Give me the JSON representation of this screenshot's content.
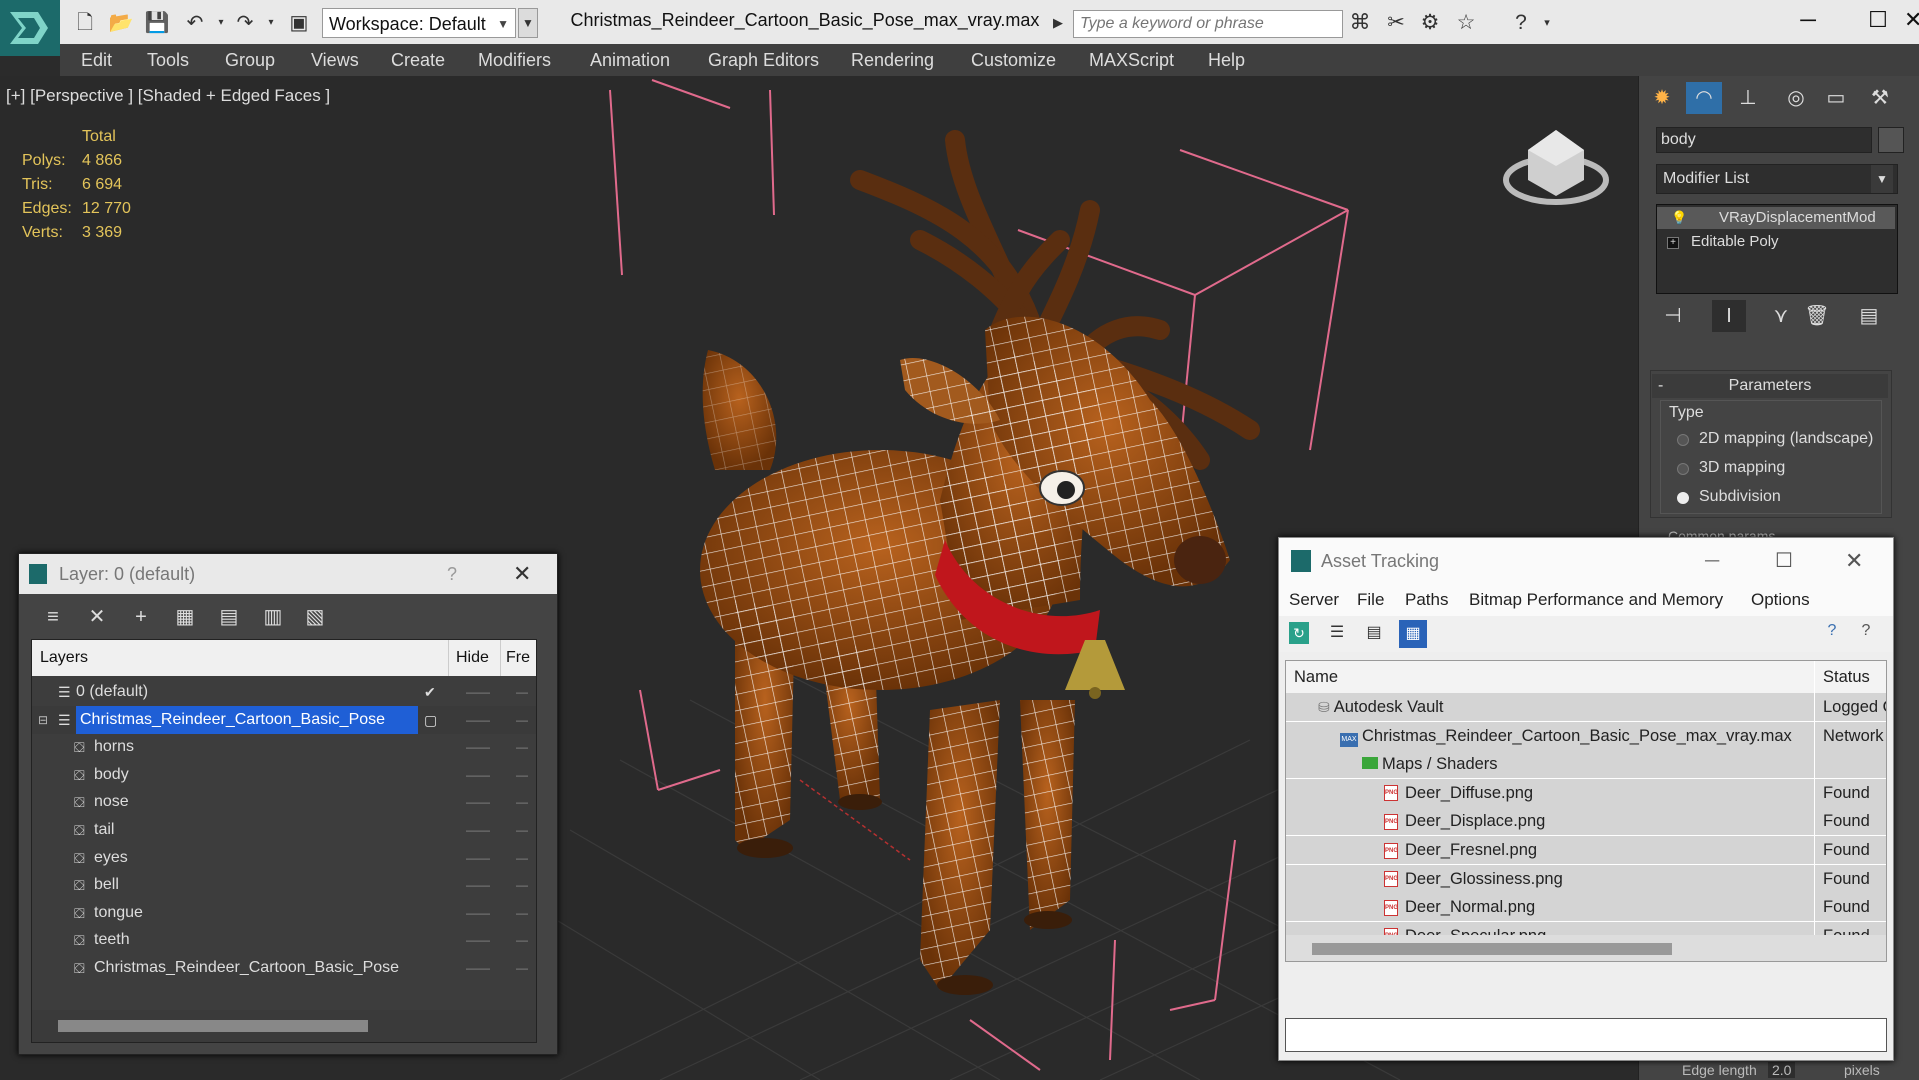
{
  "app": {
    "workspace": "Workspace: Default",
    "doc_title": "Christmas_Reindeer_Cartoon_Basic_Pose_max_vray.max",
    "search_placeholder": "Type a keyword or phrase"
  },
  "menu": [
    "Edit",
    "Tools",
    "Group",
    "Views",
    "Create",
    "Modifiers",
    "Animation",
    "Graph Editors",
    "Rendering",
    "Customize",
    "MAXScript",
    "Help"
  ],
  "viewport": {
    "label": "[+] [Perspective ] [Shaded + Edged Faces ]",
    "stats_header": "Total",
    "stats": [
      {
        "k": "Polys:",
        "v": "4 866"
      },
      {
        "k": "Tris:",
        "v": "6 694"
      },
      {
        "k": "Edges:",
        "v": "12 770"
      },
      {
        "k": "Verts:",
        "v": "3 369"
      }
    ]
  },
  "command_panel": {
    "object_name": "body",
    "modifier_list": "Modifier List",
    "stack": [
      "VRayDisplacementMod",
      "Editable Poly"
    ],
    "params_title": "Parameters",
    "type_label": "Type",
    "options": [
      {
        "label": "2D mapping (landscape)",
        "selected": false
      },
      {
        "label": "3D mapping",
        "selected": false
      },
      {
        "label": "Subdivision",
        "selected": true
      }
    ],
    "common_params": "Common params",
    "edge_length_label": "Edge length",
    "edge_length_value": "2.0",
    "edge_length_unit": "pixels"
  },
  "layer_window": {
    "title": "Layer: 0 (default)",
    "help": "?",
    "col_layers": "Layers",
    "col_hide": "Hide",
    "col_freeze": "Fre",
    "rows": [
      {
        "name": "0 (default)",
        "level": 0,
        "selected": false,
        "checked": true
      },
      {
        "name": "Christmas_Reindeer_Cartoon_Basic_Pose",
        "level": 0,
        "selected": true,
        "checked": false
      },
      {
        "name": "horns",
        "level": 1,
        "selected": false,
        "checked": false
      },
      {
        "name": "body",
        "level": 1,
        "selected": false,
        "checked": false
      },
      {
        "name": "nose",
        "level": 1,
        "selected": false,
        "checked": false
      },
      {
        "name": "tail",
        "level": 1,
        "selected": false,
        "checked": false
      },
      {
        "name": "eyes",
        "level": 1,
        "selected": false,
        "checked": false
      },
      {
        "name": "bell",
        "level": 1,
        "selected": false,
        "checked": false
      },
      {
        "name": "tongue",
        "level": 1,
        "selected": false,
        "checked": false
      },
      {
        "name": "teeth",
        "level": 1,
        "selected": false,
        "checked": false
      },
      {
        "name": "Christmas_Reindeer_Cartoon_Basic_Pose",
        "level": 1,
        "selected": false,
        "checked": false
      }
    ]
  },
  "asset_window": {
    "title": "Asset Tracking",
    "menu": [
      "Server",
      "File",
      "Paths",
      "Bitmap Performance and Memory",
      "Options"
    ],
    "col_name": "Name",
    "col_status": "Status",
    "rows": [
      {
        "name": "Autodesk Vault",
        "status": "Logged Out",
        "indent": 1,
        "icon": "vault"
      },
      {
        "name": "Christmas_Reindeer_Cartoon_Basic_Pose_max_vray.max",
        "status": "Network",
        "indent": 2,
        "icon": "max"
      },
      {
        "name": "Maps / Shaders",
        "status": "",
        "indent": 3,
        "icon": "folder"
      },
      {
        "name": "Deer_Diffuse.png",
        "status": "Found",
        "indent": 4,
        "icon": "png"
      },
      {
        "name": "Deer_Displace.png",
        "status": "Found",
        "indent": 4,
        "icon": "png"
      },
      {
        "name": "Deer_Fresnel.png",
        "status": "Found",
        "indent": 4,
        "icon": "png"
      },
      {
        "name": "Deer_Glossiness.png",
        "status": "Found",
        "indent": 4,
        "icon": "png"
      },
      {
        "name": "Deer_Normal.png",
        "status": "Found",
        "indent": 4,
        "icon": "png"
      },
      {
        "name": "Deer_Specular.png",
        "status": "Found",
        "indent": 4,
        "icon": "png"
      }
    ]
  },
  "colors": {
    "accent_blue": "#1f5fd6",
    "stats_yellow": "#e3c45a",
    "deer_brown": "#9a4d14",
    "collar_red": "#c0161c",
    "wire_white": "#ffffff",
    "bbox_pink": "#e06a8c"
  }
}
